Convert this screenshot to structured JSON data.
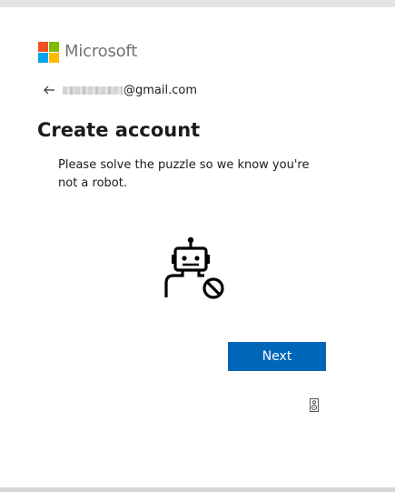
{
  "brand": {
    "name": "Microsoft",
    "colors": {
      "red": "#f25022",
      "green": "#7fba00",
      "blue": "#00a4ef",
      "yellow": "#ffb900"
    }
  },
  "identity": {
    "email_suffix": "@gmail.com",
    "back_icon": "back-arrow-icon"
  },
  "page": {
    "title": "Create account",
    "description": "Please solve the puzzle so we know you're not a robot."
  },
  "puzzle": {
    "icon": "robot-blocked-icon"
  },
  "actions": {
    "next_label": "Next",
    "accent": "#0067b8"
  },
  "audio_icon": "audio-speaker-icon"
}
